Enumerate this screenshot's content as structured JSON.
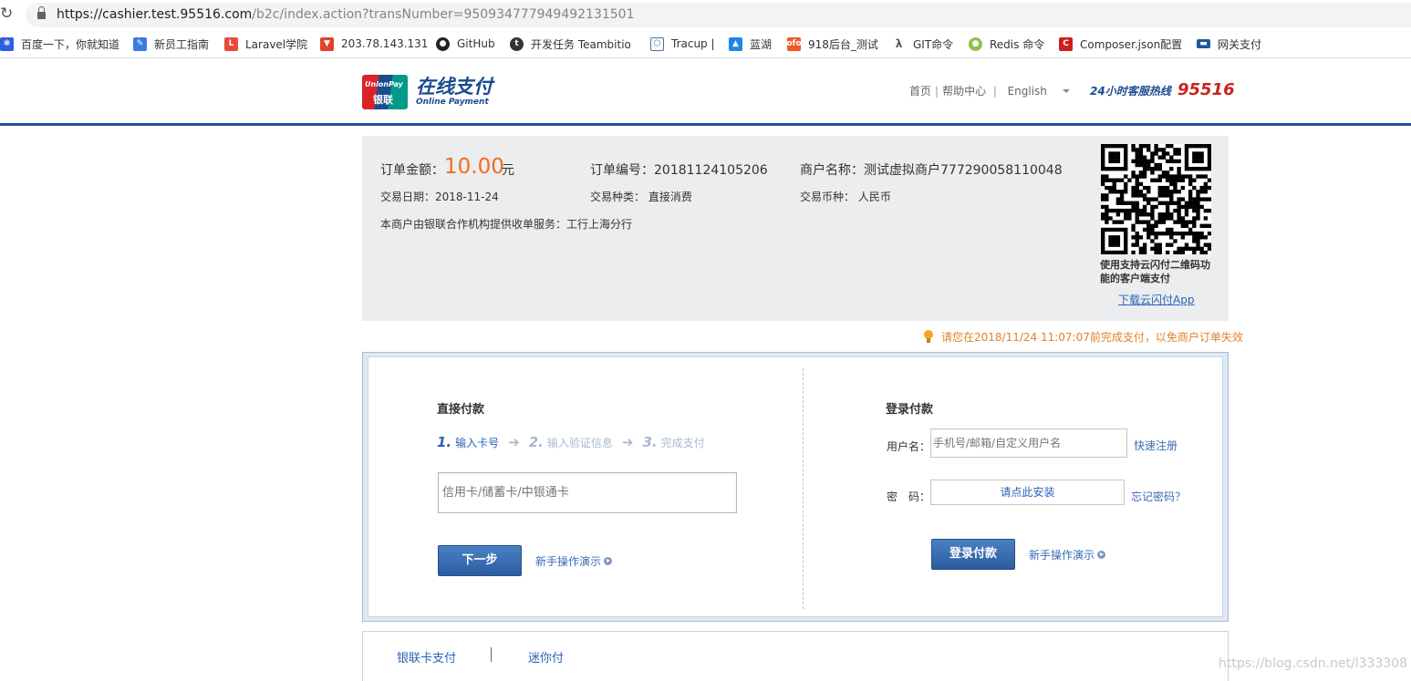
{
  "browser": {
    "url_main": "https://cashier.test.95516.com",
    "url_rest": "/b2c/index.action?transNumber=950934777949492131501",
    "bookmarks": [
      {
        "label": "百度一下，你就知道",
        "icon": "baidu-paw-icon",
        "color": "#2e5fe0"
      },
      {
        "label": "新员工指南",
        "icon": "doc-icon",
        "color": "#3b7ddd"
      },
      {
        "label": "Laravel学院",
        "icon": "laravel-icon",
        "color": "#e84a3a"
      },
      {
        "label": "203.78.143.131",
        "icon": "gitlab-icon",
        "color": "#e2432a"
      },
      {
        "label": "GitHub",
        "icon": "github-icon",
        "color": "#222222"
      },
      {
        "label": "开发任务 Teambitio",
        "icon": "teambition-icon",
        "color": "#333333"
      },
      {
        "label": "Tracup |",
        "icon": "tracup-icon",
        "color": "#4d6fa3"
      },
      {
        "label": "蓝湖",
        "icon": "lanhu-icon",
        "color": "#1e88e5"
      },
      {
        "label": "918后台_测试",
        "icon": "ofo-icon",
        "color": "#f05a28"
      },
      {
        "label": "GIT命令",
        "icon": "git-icon",
        "color": "#555555"
      },
      {
        "label": "Redis 命令",
        "icon": "redis-icon",
        "color": "#8bc34a"
      },
      {
        "label": "Composer.json配置",
        "icon": "composer-icon",
        "color": "#cc1f1f"
      },
      {
        "label": "网关支付",
        "icon": "card-icon",
        "color": "#1d5799"
      }
    ]
  },
  "header": {
    "logo_brand": "UnionPay",
    "logo_cn": "银联",
    "title": "在线支付",
    "subtitle": "Online Payment",
    "nav_home": "首页",
    "nav_help": "帮助中心",
    "nav_lang": "English",
    "hotline_label": "24小时客服热线",
    "hotline_number": "95516",
    "brand_color": "#1a4b8f",
    "accent_color": "#c8231f"
  },
  "order": {
    "amount_label": "订单金额：",
    "amount_value": "10.00",
    "amount_unit": "元",
    "order_no": "订单编号：20181124105206",
    "merchant": "商户名称：测试虚拟商户777290058110048",
    "date": "交易日期：2018-11-24",
    "trade_type": "交易种类： 直接消费",
    "currency": "交易币种： 人民币",
    "service": "本商户由银联合作机构提供收单服务：工行上海分行",
    "qr_caption": "使用支持云闪付二维码功能的客户端支付",
    "qr_link": "下载云闪付App",
    "amount_color": "#f26c1f"
  },
  "tip": "请您在2018/11/24 11:07:07前完成支付，以免商户订单失效",
  "direct_pay": {
    "title": "直接付款",
    "steps": [
      {
        "num": "1.",
        "label": "输入卡号"
      },
      {
        "num": "2.",
        "label": "输入验证信息"
      },
      {
        "num": "3.",
        "label": "完成支付"
      }
    ],
    "card_placeholder": "信用卡/储蓄卡/中银通卡",
    "next_button": "下一步",
    "demo_link": "新手操作演示"
  },
  "login_pay": {
    "title": "登录付款",
    "username_label": "用户名：",
    "username_placeholder": "手机号/邮箱/自定义用户名",
    "register_link": "快速注册",
    "password_label": "密　码：",
    "password_prompt": "请点此安装",
    "forgot_link": "忘记密码？",
    "login_button": "登录付款",
    "demo_link": "新手操作演示"
  },
  "tabs": {
    "union_card": "银联卡支付",
    "mini_pay": "迷你付"
  },
  "watermark": "https://blog.csdn.net/l333308"
}
